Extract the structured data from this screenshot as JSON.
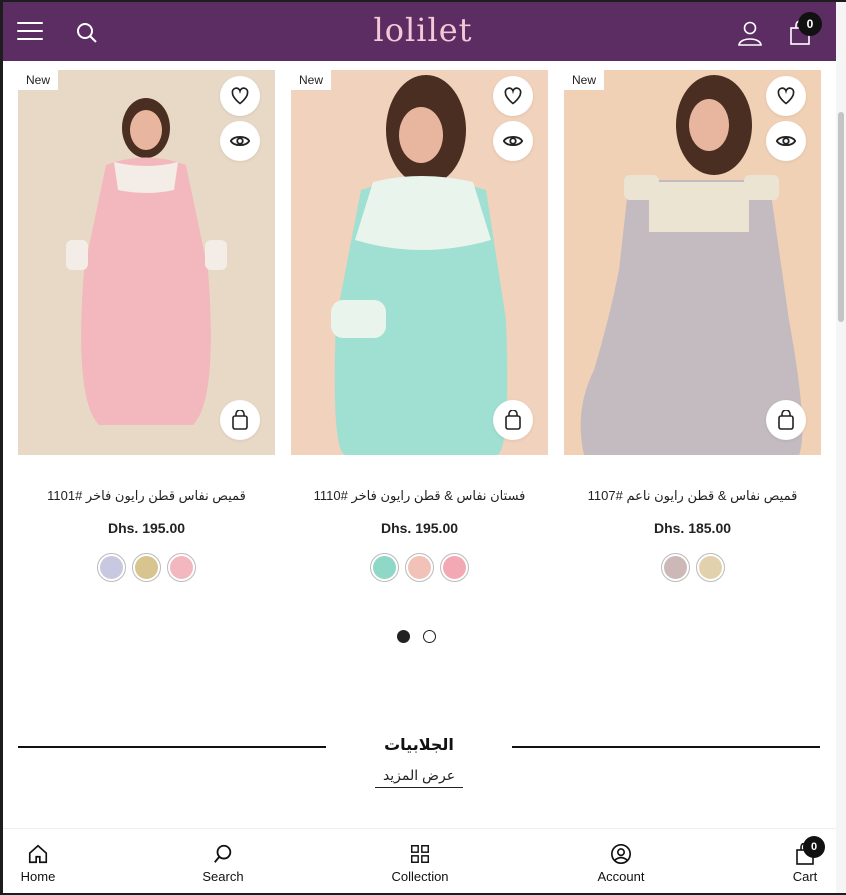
{
  "header": {
    "logo_text": "lolilet",
    "cart_count": "0",
    "bg_color": "#5b2d63"
  },
  "products": [
    {
      "badge": "New",
      "title": "قميص نفاس قطن رايون فاخر #1101",
      "price": "Dhs. 195.00",
      "dress_color": "#f3b8bd",
      "background_color": "#e8d9c6",
      "swatches": [
        "#c8c9e0",
        "#d8c48f",
        "#f2b7bf"
      ]
    },
    {
      "badge": "New",
      "title": "فستان نفاس & قطن رايون فاخر #1110",
      "price": "Dhs. 195.00",
      "dress_color": "#9fe0d2",
      "background_color": "#f1d2bc",
      "swatches": [
        "#8fd7c7",
        "#f2c1b8",
        "#f3a9b3"
      ]
    },
    {
      "badge": "New",
      "title": "قميص نفاس & قطن رايون ناعم #1107",
      "price": "Dhs. 185.00",
      "dress_color": "#c3bbbf",
      "background_color": "#f1d1b5",
      "swatches": [
        "#cdb8b8",
        "#e2d1ad"
      ]
    }
  ],
  "pagination": {
    "pages": 2,
    "active": 1
  },
  "section": {
    "title": "الجلابيات",
    "view_more": "عرض المزيد"
  },
  "bottom_nav": [
    {
      "label": "Home",
      "icon": "home-icon"
    },
    {
      "label": "Search",
      "icon": "search-icon"
    },
    {
      "label": "Collection",
      "icon": "grid-icon"
    },
    {
      "label": "Account",
      "icon": "account-icon"
    },
    {
      "label": "Cart",
      "icon": "cart-icon"
    }
  ],
  "bottom_cart_count": "0"
}
